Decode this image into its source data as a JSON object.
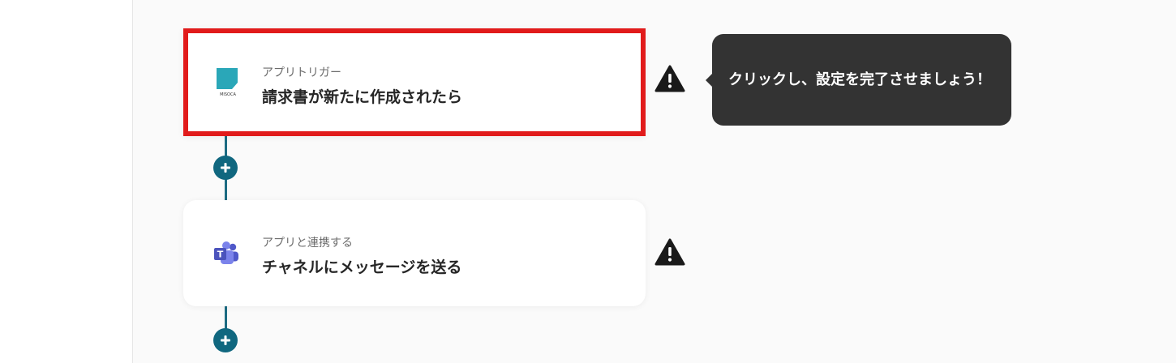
{
  "flow": {
    "steps": [
      {
        "subtitle": "アプリトリガー",
        "title": "請求書が新たに作成されたら",
        "app_icon": "misoca-logo-icon",
        "app_icon_text": "MISOCA",
        "selected": true,
        "warning": true
      },
      {
        "subtitle": "アプリと連携する",
        "title": "チャネルにメッセージを送る",
        "app_icon": "microsoft-teams-icon",
        "app_icon_text": "T",
        "selected": false,
        "warning": true
      }
    ],
    "tooltip": "クリックし、設定を完了させましょう！"
  },
  "colors": {
    "accent": "#10677f",
    "highlight_border": "#e11b1b",
    "tooltip_bg": "#333333",
    "misoca_brand": "#2aa7b8",
    "teams_brand": "#5059c9"
  }
}
